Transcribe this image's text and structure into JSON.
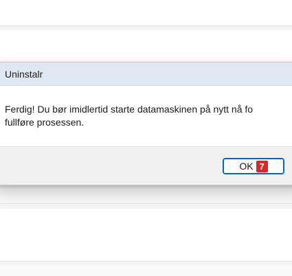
{
  "dialog": {
    "title": "Uninstalr",
    "message_line1": "Ferdig! Du bør imidlertid starte datamaskinen på nytt nå fo",
    "message_line2": "fullføre prosessen.",
    "ok_label": "OK",
    "ok_badge": "7"
  },
  "colors": {
    "titlebar": "#dfe7f3",
    "footer": "#f0f0f0",
    "button_border": "#0067c0",
    "badge": "#d8282b"
  }
}
